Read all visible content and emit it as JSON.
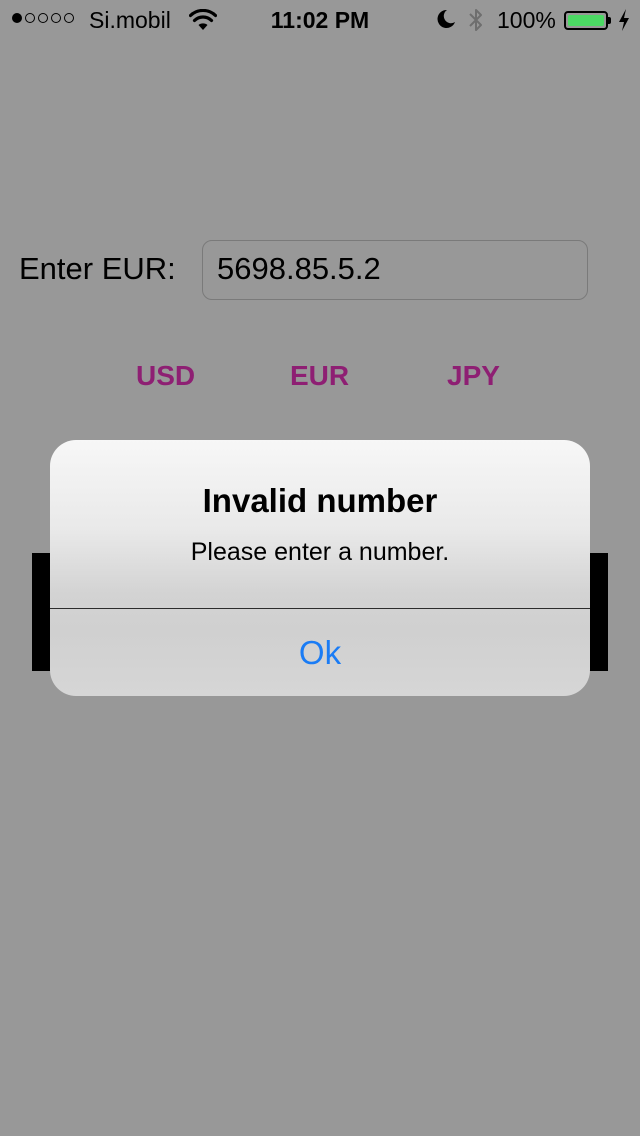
{
  "status_bar": {
    "signal_bars_filled": 1,
    "signal_bars_total": 5,
    "carrier": "Si.mobil",
    "time": "11:02 PM",
    "battery_percent": "100%",
    "battery_level": 1.0,
    "battery_color": "#4cd964",
    "icons": [
      "wifi-icon",
      "moon-icon",
      "bluetooth-icon",
      "battery-icon",
      "charging-bolt-icon"
    ]
  },
  "converter": {
    "label": "Enter EUR:",
    "input_value": "5698.85.5.2",
    "currencies": [
      "USD",
      "EUR",
      "JPY"
    ],
    "currency_color": "#8e1f73"
  },
  "alert": {
    "title": "Invalid number",
    "message": "Please enter a number.",
    "button_label": "Ok",
    "button_color": "#1a7cf5"
  },
  "colors": {
    "background": "#989898",
    "result_bar": "#000000"
  }
}
